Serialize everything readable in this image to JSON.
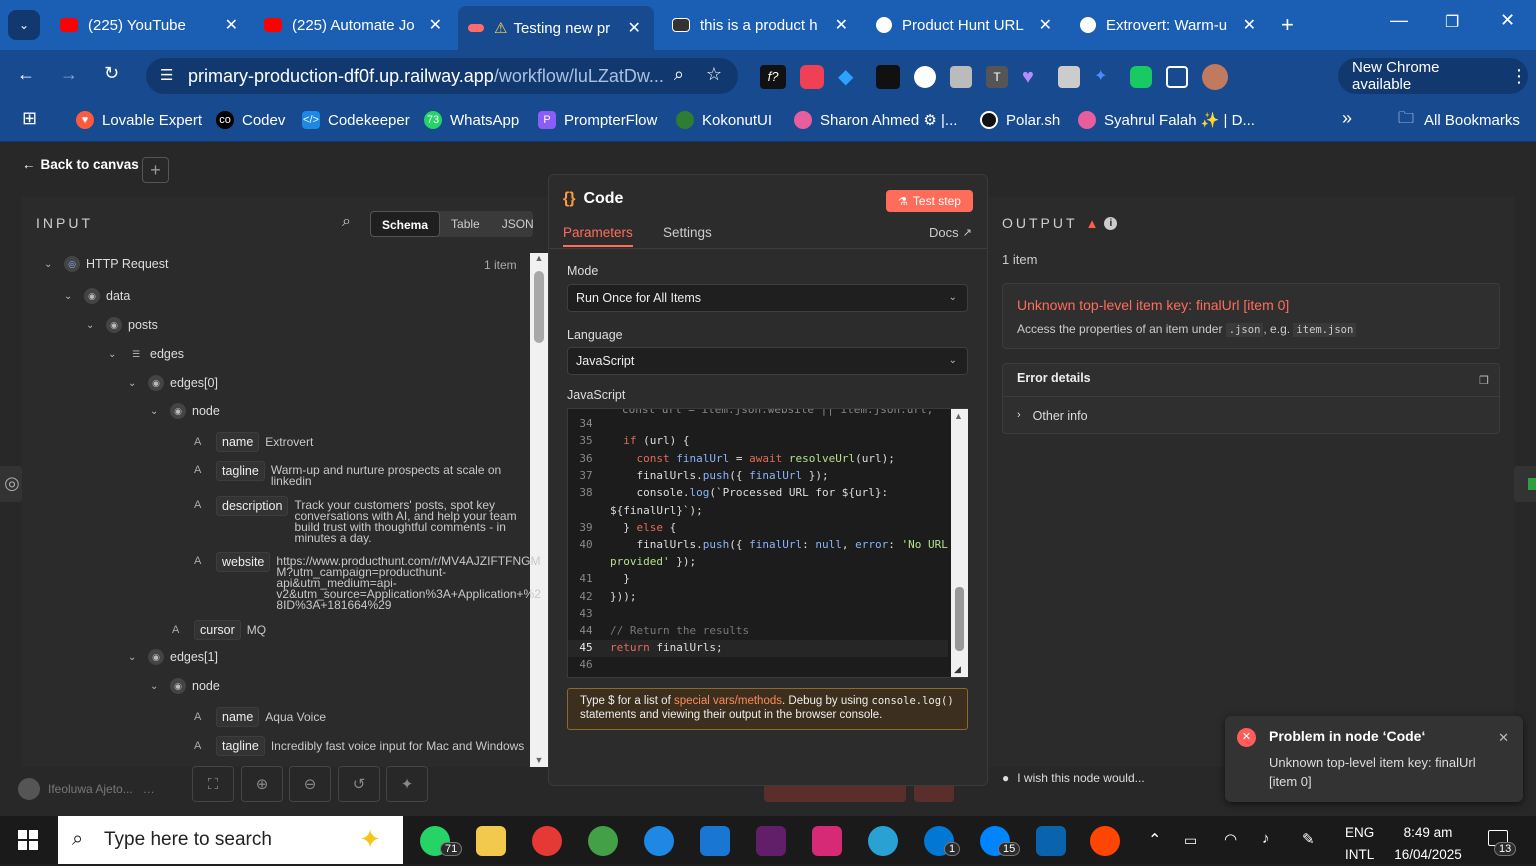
{
  "browser": {
    "tabs": [
      {
        "title": "(225) YouTube",
        "color": "#ff0000"
      },
      {
        "title": "(225) Automate Jo",
        "color": "#ff0000"
      },
      {
        "title": "Testing new pr",
        "color": "#ff6b6b"
      },
      {
        "title": "this is a product h",
        "color": "#ffffff"
      },
      {
        "title": "Product Hunt URL",
        "color": "#ffffff"
      },
      {
        "title": "Extrovert: Warm-u",
        "color": "#ffffff"
      }
    ],
    "url_main": "primary-production-df0f.up.railway.app",
    "url_rest": "/workflow/luLZatDw...",
    "chrome_available": "New Chrome available",
    "bookmarks": [
      "Lovable Expert",
      "Codev",
      "Codekeeper",
      "WhatsApp",
      "PrompterFlow",
      "KokonutUI",
      "Sharon Ahmed ⚙ |...",
      "Polar.sh",
      "Syahrul Falah ✨ | D..."
    ],
    "all_bookmarks": "All Bookmarks"
  },
  "app": {
    "back_label": "Back to canvas",
    "input": {
      "title": "INPUT",
      "views": [
        "Schema",
        "Table",
        "JSON"
      ],
      "root": "HTTP Request",
      "root_count": "1 item",
      "tree": {
        "data": "data",
        "posts": "posts",
        "edges": "edges",
        "edges0": "edges[0]",
        "node": "node",
        "name_key": "name",
        "name_val": "Extrovert",
        "tagline_key": "tagline",
        "tagline_val1": "Warm-up and nurture prospects at scale on",
        "tagline_val2": "linkedin",
        "desc_key": "description",
        "desc_val": [
          "Track your customers' posts, spot key",
          "conversations with AI, and help your team",
          "build trust with thoughtful comments - in",
          "minutes a day."
        ],
        "web_key": "website",
        "web_val": [
          "https://www.producthunt.com/r/MV4AJZIFTFNGM",
          "M?utm_campaign=producthunt-",
          "api&utm_medium=api-",
          "v2&utm_source=Application%3A+Application+%2",
          "8ID%3A+181664%29"
        ],
        "cursor_key": "cursor",
        "cursor_val": "MQ",
        "edges1": "edges[1]",
        "node2": "node",
        "name2_val": "Aqua Voice",
        "tagline2_val": "Incredibly fast voice input for Mac and Windows"
      }
    },
    "code": {
      "title": "Code",
      "test_step": "Test step",
      "tabs": [
        "Parameters",
        "Settings"
      ],
      "docs": "Docs",
      "mode_label": "Mode",
      "mode_value": "Run Once for All Items",
      "language_label": "Language",
      "language_value": "JavaScript",
      "js_label": "JavaScript",
      "lines": [
        "34",
        "35",
        "36",
        "37",
        "38",
        "",
        "39",
        "40",
        "",
        "41",
        "42",
        "43",
        "44",
        "45",
        "46"
      ],
      "hint_1": "Type $ for a list of ",
      "hint_link": "special vars/methods",
      "hint_2": ". Debug by using ",
      "hint_code": "console.log()",
      "hint_3": "statements and viewing their output in the browser console."
    },
    "output": {
      "title": "OUTPUT",
      "count": "1 item",
      "error_title": "Unknown top-level item key: finalUrl [item 0]",
      "error_desc_1": "Access the properties of an item under ",
      "error_code_1": ".json",
      "error_desc_2": ", e.g. ",
      "error_code_2": "item.json",
      "details_title": "Error details",
      "other_info": "Other info",
      "wish": "I wish this node would..."
    },
    "toast": {
      "title": "Problem in node ‘Code‘",
      "body_1": "Unknown top-level item key: finalUrl",
      "body_2": "[item 0]"
    },
    "user": "Ifeoluwa Ajeto..."
  },
  "taskbar": {
    "search_placeholder": "Type here to search",
    "lang_1": "ENG",
    "lang_2": "INTL",
    "time": "8:49 am",
    "date": "16/04/2025",
    "badges": {
      "whatsapp": "71",
      "skype": "1",
      "messenger": "15",
      "notif": "13"
    }
  }
}
